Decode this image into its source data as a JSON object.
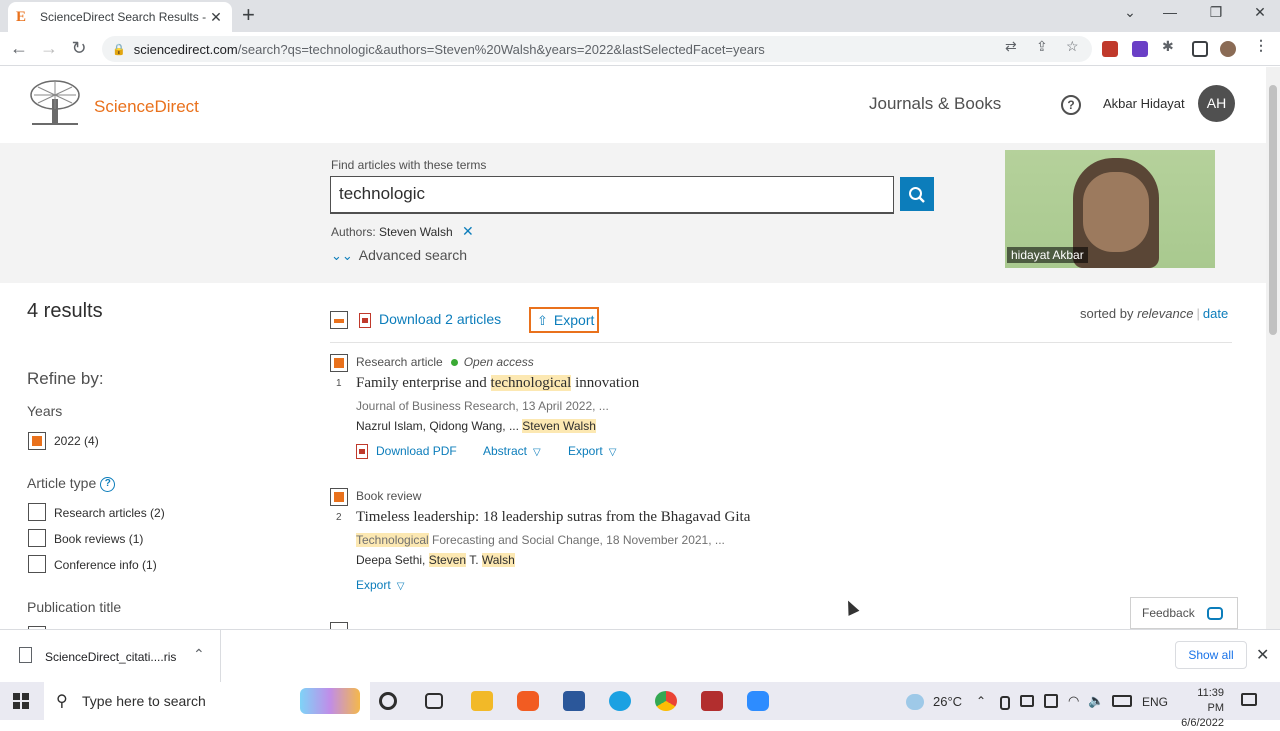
{
  "browser": {
    "tab_title": "ScienceDirect Search Results - Ke",
    "url_host": "sciencedirect.com",
    "url_path": "/search?qs=technologic&authors=Steven%20Walsh&years=2022&lastSelectedFacet=years"
  },
  "header": {
    "brand": "ScienceDirect",
    "nav_link": "Journals & Books",
    "user_name": "Akbar Hidayat",
    "avatar_initials": "AH"
  },
  "search": {
    "label": "Find articles with these terms",
    "query": "technologic",
    "authors_label": "Authors:",
    "authors_value": "Steven Walsh",
    "advanced": "Advanced search"
  },
  "webcam": {
    "caption": "hidayat Akbar"
  },
  "sidebar": {
    "results_count": "4 results",
    "refine": "Refine by:",
    "years_heading": "Years",
    "years": [
      {
        "label": "2022 (4)",
        "checked": true
      }
    ],
    "type_heading": "Article type",
    "types": [
      {
        "label": "Research articles (2)"
      },
      {
        "label": "Book reviews (1)"
      },
      {
        "label": "Conference info (1)"
      }
    ],
    "pub_heading": "Publication title"
  },
  "toolbar": {
    "download": "Download 2 articles",
    "export": "Export",
    "sorted_by": "sorted by",
    "relevance": "relevance",
    "date": "date"
  },
  "results": [
    {
      "num": "1",
      "type": "Research article",
      "access": "Open access",
      "title_pre": "Family enterprise and ",
      "title_hl": "technological",
      "title_post": " innovation",
      "journal": "Journal of Business Research, 13 April 2022, ...",
      "authors_pre": "Nazrul Islam, Qidong Wang, ... ",
      "authors_hl": "Steven Walsh",
      "actions": {
        "pdf": "Download PDF",
        "abstract": "Abstract",
        "export": "Export"
      }
    },
    {
      "num": "2",
      "type": "Book review",
      "title": "Timeless leadership: 18 leadership sutras from the Bhagavad Gita",
      "journal_hl": "Technological",
      "journal_post": " Forecasting and Social Change, 18 November 2021, ...",
      "authors_pre": "Deepa Sethi, ",
      "authors_hl1": "Steven",
      "authors_mid": " T. ",
      "authors_hl2": "Walsh",
      "actions": {
        "export": "Export"
      }
    }
  ],
  "feedback": "Feedback",
  "downloads": {
    "file": "ScienceDirect_citati....ris",
    "show_all": "Show all"
  },
  "taskbar": {
    "search_placeholder": "Type here to search",
    "temperature": "26°C",
    "lang": "ENG",
    "time": "11:39 PM",
    "date": "6/6/2022"
  },
  "colors": {
    "brand_orange": "#e9711c",
    "link_blue": "#0c7dbb",
    "highlight": "#fce8b2"
  }
}
